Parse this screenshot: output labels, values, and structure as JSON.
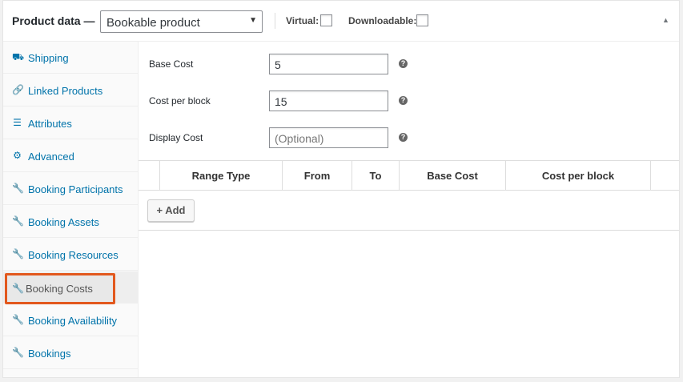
{
  "header": {
    "title": "Product data —",
    "product_type": "Bookable product",
    "virtual_label": "Virtual:",
    "downloadable_label": "Downloadable:",
    "collapse_icon": "triangle-up-icon"
  },
  "sidebar": {
    "items": [
      {
        "label": "Shipping",
        "icon": "truck-icon",
        "glyph": "⛟"
      },
      {
        "label": "Linked Products",
        "icon": "link-icon",
        "glyph": "🔗"
      },
      {
        "label": "Attributes",
        "icon": "list-icon",
        "glyph": "☰"
      },
      {
        "label": "Advanced",
        "icon": "gear-icon",
        "glyph": "⚙"
      },
      {
        "label": "Booking Participants",
        "icon": "wrench-icon",
        "glyph": "🔧"
      },
      {
        "label": "Booking Assets",
        "icon": "wrench-icon",
        "glyph": "🔧"
      },
      {
        "label": "Booking Resources",
        "icon": "wrench-icon",
        "glyph": "🔧"
      },
      {
        "label": "Booking Costs",
        "icon": "wrench-icon",
        "glyph": "🔧",
        "active": true
      },
      {
        "label": "Booking Availability",
        "icon": "wrench-icon",
        "glyph": "🔧"
      },
      {
        "label": "Bookings",
        "icon": "wrench-icon",
        "glyph": "🔧"
      }
    ]
  },
  "fields": {
    "base_cost": {
      "label": "Base Cost",
      "value": "5"
    },
    "cost_per_block": {
      "label": "Cost per block",
      "value": "15"
    },
    "display_cost": {
      "label": "Display Cost",
      "placeholder": "(Optional)"
    },
    "help_glyph": "?"
  },
  "table": {
    "headers": [
      "Range Type",
      "From",
      "To",
      "Base Cost",
      "Cost per block"
    ]
  },
  "add_button": "+ Add",
  "colors": {
    "accent": "#0073aa",
    "highlight": "#e2581d"
  }
}
